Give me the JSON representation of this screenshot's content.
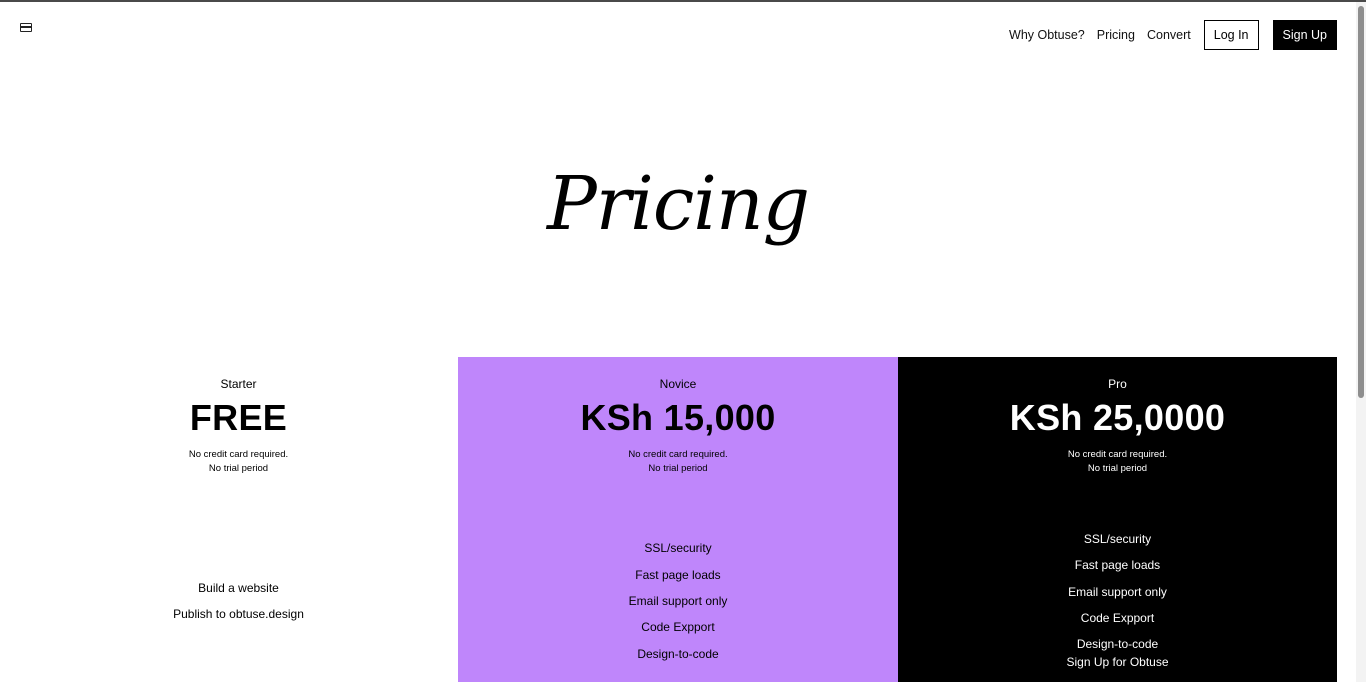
{
  "header": {
    "logo_icon": "card-icon",
    "nav": {
      "why": "Why Obtuse?",
      "pricing": "Pricing",
      "convert": "Convert",
      "login": "Log In",
      "signup": "Sign Up"
    }
  },
  "hero": {
    "title": "Pricing"
  },
  "plans": [
    {
      "name": "Starter",
      "price": "FREE",
      "note1": "No credit card required.",
      "note2": "No trial period",
      "features": [
        "Build a website",
        "Publish to obtuse.design"
      ]
    },
    {
      "name": "Novice",
      "price": "KSh 15,000",
      "note1": "No credit card required.",
      "note2": "No trial period",
      "features": [
        "SSL/security",
        "Fast page loads",
        "Email support only",
        "Code Expport",
        "Design-to-code"
      ]
    },
    {
      "name": "Pro",
      "price": "KSh 25,0000",
      "note1": "No credit card required.",
      "note2": "No trial period",
      "features": [
        "SSL/security",
        "Fast page loads",
        "Email support only",
        "Code Expport",
        "Design-to-code",
        "Sign Up for Obtuse"
      ]
    }
  ],
  "colors": {
    "novice_bg": "#bf86fb",
    "pro_bg": "#000000"
  }
}
